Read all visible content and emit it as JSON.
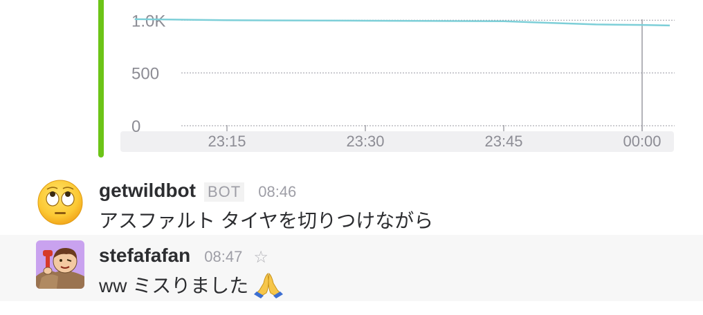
{
  "chart_data": {
    "type": "line",
    "x_tick_labels": [
      "23:15",
      "23:30",
      "23:45",
      "00:00"
    ],
    "y_tick_labels": [
      "0",
      "500",
      "1.0K"
    ],
    "ylim": [
      0,
      1100
    ],
    "grid": true,
    "series": [
      {
        "color": "#7dcfd8",
        "x": [
          "23:05",
          "23:15",
          "23:30",
          "23:45",
          "23:50",
          "23:55",
          "00:00",
          "00:03"
        ],
        "values": [
          1010,
          1000,
          995,
          990,
          975,
          960,
          955,
          950
        ]
      }
    ],
    "cursor_x": "00:00"
  },
  "messages": [
    {
      "author": "getwildbot",
      "badge": "BOT",
      "time": "08:46",
      "text": "アスファルト タイヤを切りつけながら",
      "avatar_icon": "rolling-eyes-emoji-icon"
    },
    {
      "author": "stefafafan",
      "time": "08:47",
      "text": "ww ミスりました",
      "avatar_icon": "user-avatar-icon",
      "emoji_icon": "pray-icon",
      "star_icon": "star-outline-icon"
    }
  ],
  "colors": {
    "attachment_bar": "#6cc417",
    "line": "#7dcfd8"
  }
}
